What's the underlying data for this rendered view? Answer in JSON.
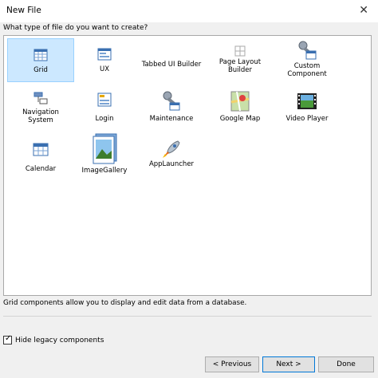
{
  "window": {
    "title": "New File"
  },
  "prompt": "What type of file do you want to create?",
  "tiles": [
    {
      "label": "Grid",
      "icon": "grid-icon",
      "selected": true
    },
    {
      "label": "UX",
      "icon": "ux-icon"
    },
    {
      "label": "Tabbed UI Builder",
      "icon": "tabbed-ui-icon"
    },
    {
      "label": "Page Layout Builder",
      "icon": "page-layout-icon"
    },
    {
      "label": "Custom Component",
      "icon": "custom-component-icon"
    },
    {
      "label": "Navigation System",
      "icon": "navigation-icon"
    },
    {
      "label": "Login",
      "icon": "login-icon"
    },
    {
      "label": "Maintenance",
      "icon": "maintenance-icon"
    },
    {
      "label": "Google Map",
      "icon": "google-map-icon"
    },
    {
      "label": "Video Player",
      "icon": "video-player-icon"
    },
    {
      "label": "Calendar",
      "icon": "calendar-icon"
    },
    {
      "label": "ImageGallery",
      "icon": "image-gallery-icon"
    },
    {
      "label": "AppLauncher",
      "icon": "app-launcher-icon"
    }
  ],
  "description": "Grid components allow you to display and edit data from a database.",
  "hide_legacy": {
    "label": "Hide legacy components",
    "checked": true
  },
  "buttons": {
    "previous": "< Previous",
    "next": "Next >",
    "done": "Done"
  },
  "colors": {
    "selection": "#cce8ff",
    "selection_border": "#99d1ff",
    "accent": "#0078d7"
  }
}
